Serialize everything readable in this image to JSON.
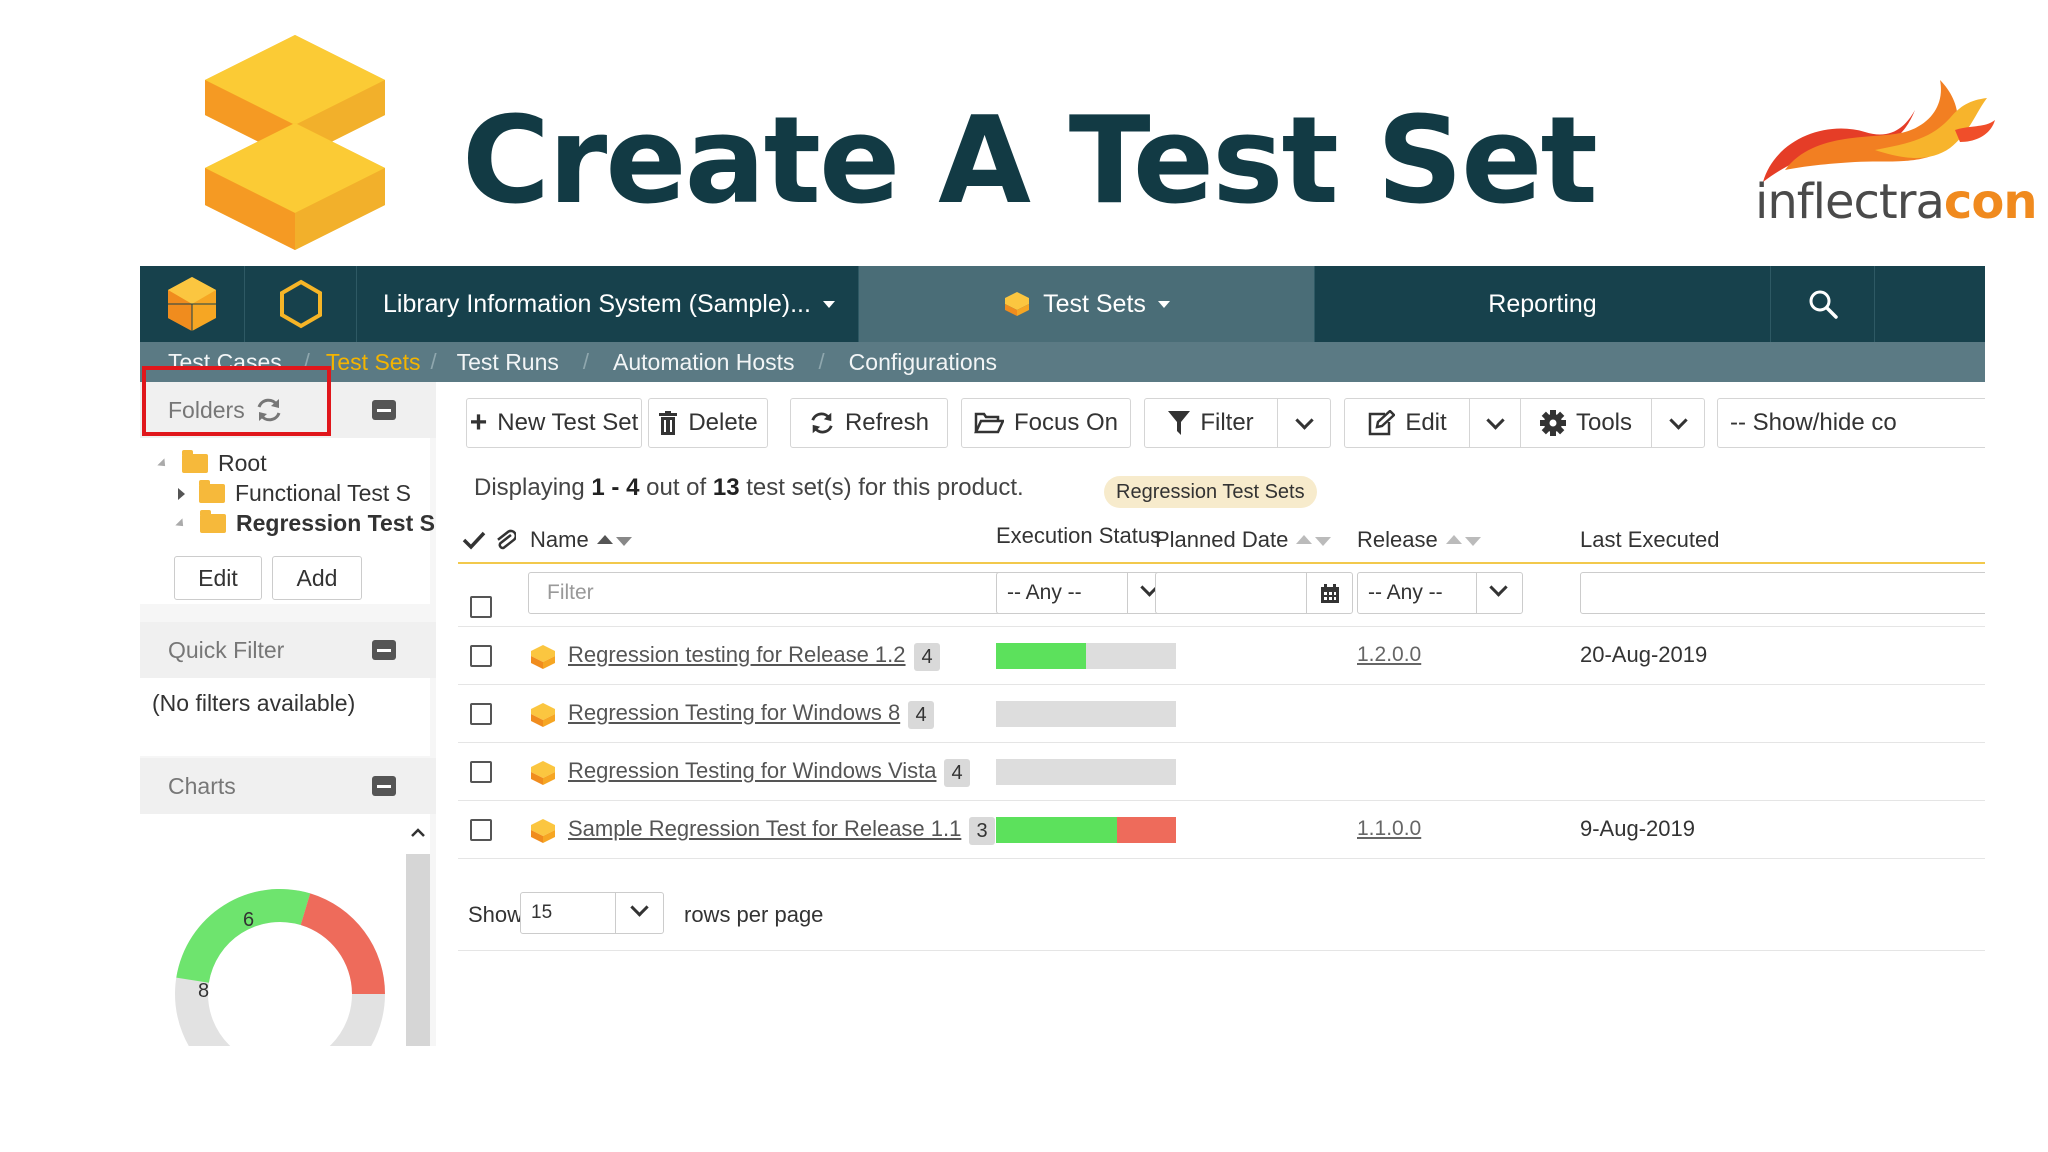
{
  "slide": {
    "title": "Create A Test Set",
    "brand_part1": "inflectra",
    "brand_part2": "con"
  },
  "topnav": {
    "project": "Library Information System (Sample)...",
    "artifact": "Test Sets",
    "reporting": "Reporting"
  },
  "subnav": {
    "items": [
      "Test Cases",
      "Test Sets",
      "Test Runs",
      "Automation Hosts",
      "Configurations"
    ]
  },
  "sidebar": {
    "folders_label": "Folders",
    "tree": {
      "root": "Root",
      "child1": "Functional Test S",
      "child2": "Regression Test S"
    },
    "edit_label": "Edit",
    "add_label": "Add",
    "quick_filter_label": "Quick Filter",
    "no_filters": "(No filters available)",
    "charts_label": "Charts",
    "chart_data": {
      "type": "pie",
      "values": [
        8,
        6
      ],
      "labels": [
        "8",
        "6"
      ],
      "colors": [
        "#6ee46e",
        "#ee6b5b",
        "#e2e2e2"
      ]
    }
  },
  "toolbar": {
    "new_label": "New Test Set",
    "delete_label": "Delete",
    "refresh_label": "Refresh",
    "focus_label": "Focus On",
    "filter_label": "Filter",
    "edit_label": "Edit",
    "tools_label": "Tools",
    "showhide_label": "-- Show/hide co"
  },
  "listing": {
    "display_prefix": "Displaying",
    "range_start": "1",
    "range_dash": "-",
    "range_end": "4",
    "out_of": "out of",
    "total": "13",
    "suffix": "test set(s) for this product.",
    "folder_pill": "Regression Test Sets"
  },
  "columns": {
    "name": "Name",
    "execution_status": "Execution Status",
    "planned_date": "Planned Date",
    "release": "Release",
    "last_executed": "Last Executed"
  },
  "filters": {
    "name_placeholder": "Filter",
    "status_any": "-- Any --",
    "release_any": "-- Any --"
  },
  "rows": [
    {
      "name": "Regression testing for Release 1.2",
      "count": "4",
      "passed": 0.5,
      "failed": 0,
      "release": "1.2.0.0",
      "last_executed": "20-Aug-2019"
    },
    {
      "name": "Regression Testing for Windows 8",
      "count": "4",
      "passed": 0,
      "failed": 0,
      "release": "",
      "last_executed": ""
    },
    {
      "name": "Regression Testing for Windows Vista",
      "count": "4",
      "passed": 0,
      "failed": 0,
      "release": "",
      "last_executed": ""
    },
    {
      "name": "Sample Regression Test for Release 1.1",
      "count": "3",
      "passed": 0.67,
      "failed": 0.33,
      "release": "1.1.0.0",
      "last_executed": "9-Aug-2019"
    }
  ],
  "pager": {
    "show_label": "Show",
    "page_size": "15",
    "rows_label": "rows per page"
  }
}
